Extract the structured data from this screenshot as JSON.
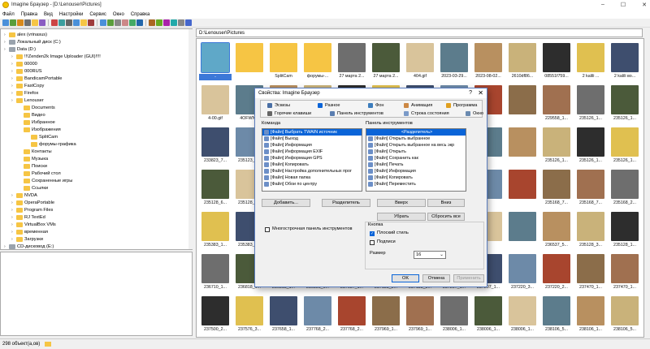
{
  "window": {
    "title": "Imagine Браузер - [D:\\Lenouser\\Pictures]"
  },
  "menu": [
    "Файл",
    "Правка",
    "Вид",
    "Настройки",
    "Сервис",
    "Окно",
    "Справка"
  ],
  "toolbar_icons": [
    "new-icon",
    "back-icon",
    "forward-icon",
    "up-icon",
    "folder-icon",
    "copy-icon",
    "cut-icon",
    "paste-icon",
    "delete-icon",
    "rename-icon",
    "refresh-icon",
    "properties-icon",
    "view-thumbs-icon",
    "view-list-icon",
    "sort-icon",
    "filter-icon",
    "select-all-icon",
    "zoom-in-icon",
    "zoom-out-icon",
    "rotate-icon",
    "slideshow-icon",
    "batch-icon",
    "settings-icon",
    "help-icon"
  ],
  "tree": [
    {
      "label": "alex (vrinasus)",
      "level": 0,
      "type": "folder"
    },
    {
      "label": "Локальный диск (C:)",
      "level": 0,
      "type": "drive"
    },
    {
      "label": "Data (D:)",
      "level": 0,
      "type": "drive"
    },
    {
      "label": "!!!Zenden2k Image Uploader (GUI)!!!!",
      "level": 1,
      "type": "folder"
    },
    {
      "label": "00000",
      "level": 1,
      "type": "folder"
    },
    {
      "label": "000RUS",
      "level": 1,
      "type": "folder"
    },
    {
      "label": "BandicamPortable",
      "level": 1,
      "type": "folder"
    },
    {
      "label": "FastCopy",
      "level": 1,
      "type": "folder"
    },
    {
      "label": "Firefox",
      "level": 1,
      "type": "folder"
    },
    {
      "label": "Lenouser",
      "level": 1,
      "type": "folder"
    },
    {
      "label": "Documents",
      "level": 2,
      "type": "folder"
    },
    {
      "label": "Видео",
      "level": 2,
      "type": "folder"
    },
    {
      "label": "Избранное",
      "level": 2,
      "type": "folder"
    },
    {
      "label": "Изображения",
      "level": 2,
      "type": "folder"
    },
    {
      "label": "SplitCam",
      "level": 3,
      "type": "folder"
    },
    {
      "label": "форумы-графика",
      "level": 3,
      "type": "folder"
    },
    {
      "label": "Контакты",
      "level": 2,
      "type": "folder"
    },
    {
      "label": "Музыка",
      "level": 2,
      "type": "folder"
    },
    {
      "label": "Поиски",
      "level": 2,
      "type": "folder"
    },
    {
      "label": "Рабочий стол",
      "level": 2,
      "type": "folder"
    },
    {
      "label": "Сохраненные игры",
      "level": 2,
      "type": "folder"
    },
    {
      "label": "Ссылки",
      "level": 2,
      "type": "folder"
    },
    {
      "label": "NVDA",
      "level": 1,
      "type": "folder"
    },
    {
      "label": "OperaPortable",
      "level": 1,
      "type": "folder"
    },
    {
      "label": "Program Files",
      "level": 1,
      "type": "folder"
    },
    {
      "label": "RJ TextEd",
      "level": 1,
      "type": "folder"
    },
    {
      "label": "VirtualBox VMs",
      "level": 1,
      "type": "folder"
    },
    {
      "label": "временная",
      "level": 1,
      "type": "folder"
    },
    {
      "label": "Загрузки",
      "level": 1,
      "type": "folder"
    },
    {
      "label": "CD-дисковод (E:)",
      "level": 0,
      "type": "drive"
    }
  ],
  "path": "D:\\Lenouser\\Pictures",
  "grid_rows": [
    [
      "..",
      "",
      "SplitCam",
      "форумы-...",
      "27 марта 2...",
      "27 марта 2...",
      "404.gif",
      "2023-03-29...",
      "2023-08-02...",
      "2610df86...",
      "08551f759...",
      "2 kalili ...",
      "2 kalili во..."
    ],
    [
      "4-00.gif",
      "4OFWN...",
      "",
      "",
      "",
      "",
      "",
      "",
      "",
      "",
      "229558_1...",
      "235126_1...",
      "235126_1..."
    ],
    [
      "233823_7...",
      "235123_1...",
      "",
      "",
      "",
      "",
      "",
      "",
      "",
      "",
      "235126_1...",
      "235126_1...",
      "235126_1..."
    ],
    [
      "235128_6...",
      "235128_1...",
      "",
      "",
      "",
      "",
      "",
      "",
      "",
      "",
      "235168_7...",
      "235168_7...",
      "235168_2..."
    ],
    [
      "235383_1...",
      "235383_1...",
      "",
      "",
      "",
      "",
      "",
      "",
      "",
      "",
      "236537_5...",
      "235128_3...",
      "235128_1..."
    ],
    [
      "236710_1...",
      "236818_1...",
      "236818_1...",
      "236895_6...",
      "237057_1...",
      "237138_2...",
      "237138_2...",
      "237207_1...",
      "237207_1...",
      "237220_3...",
      "237220_2...",
      "237470_1...",
      "237470_1..."
    ],
    [
      "237500_2...",
      "237576_3...",
      "237658_1...",
      "237768_2...",
      "237768_2...",
      "237969_1...",
      "237969_1...",
      "238006_1...",
      "238006_1...",
      "238006_1...",
      "238106_5...",
      "238106_1...",
      "238106_5..."
    ]
  ],
  "status": "298 объект(а,ов)",
  "dialog": {
    "title": "Свойства: Imagine Браузер",
    "tabs": [
      "Эскизы",
      "Разное",
      "Фон",
      "Анимация",
      "Программа",
      "Горячие клавиши",
      "Панель инструментов",
      "Строка состояния",
      "Окно"
    ],
    "commands_label": "Команда",
    "commands": [
      "[Файл] Выбрать TWAIN источник",
      "[Файл] Выход",
      "[Файл] Информация",
      "[Файл] Информация EXIF",
      "[Файл] Информация GPS",
      "[Файл] Копировать",
      "[Файл] Настройка дополнительных прог",
      "[Файл] Новая папка",
      "[Файл] Обои по центру"
    ],
    "panel_label": "Панель инструментов",
    "panel": [
      "<Разделитель>",
      "[Файл] Открыть выбранное",
      "[Файл] Открыть выбранное на весь экр",
      "[Файл] Открыть",
      "[Файл] Сохранить как",
      "[Файл] Печать",
      "[Файл] Информация",
      "[Файл] Копировать",
      "[Файл] Переместить"
    ],
    "buttons": {
      "add": "Добавить...",
      "separator": "Разделитель",
      "up": "Вверх",
      "down": "Вниз",
      "remove": "Убрать",
      "reset": "Сбросить все",
      "ok": "OK",
      "cancel": "Отмена",
      "apply": "Применить"
    },
    "multiline_label": "Многострочная панель инструментов",
    "group_label": "Кнопка",
    "flat_label": "Плоский стиль",
    "captions_label": "Подписи",
    "size_label": "Размер",
    "size_value": "16"
  }
}
